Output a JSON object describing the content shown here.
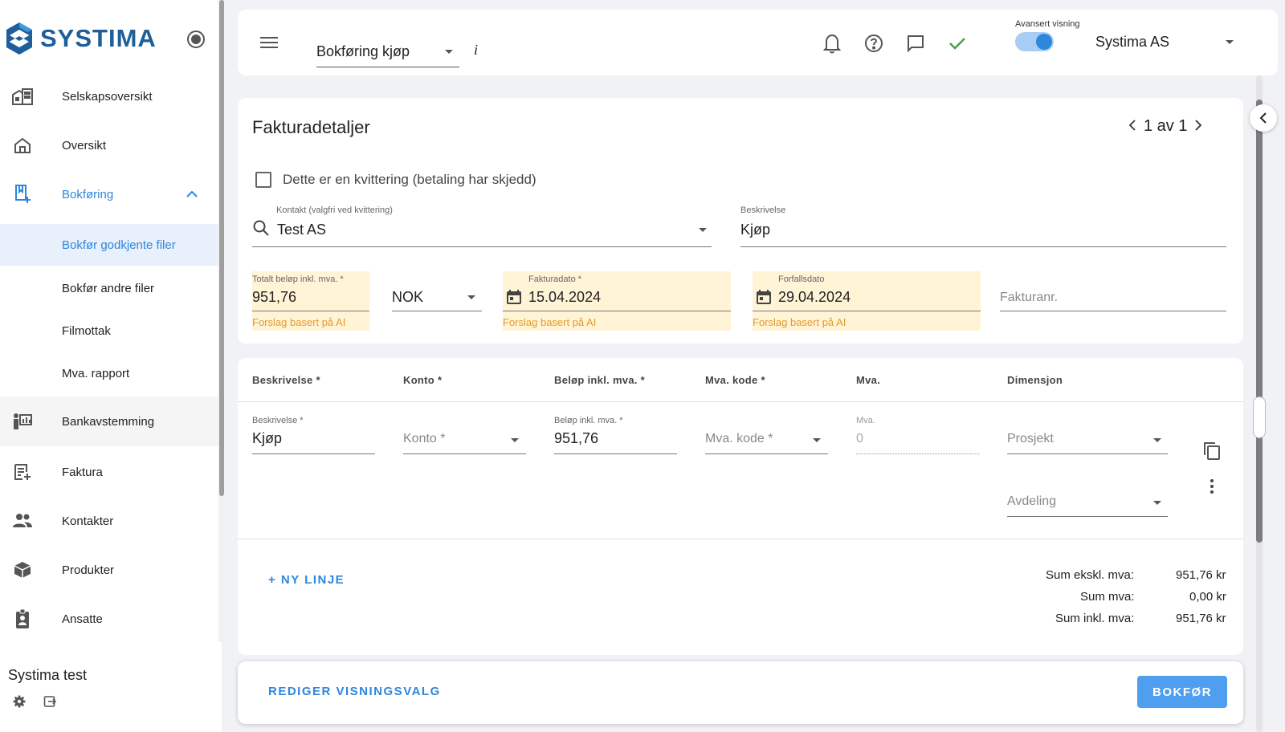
{
  "brand": {
    "name": "SYSTIMA"
  },
  "colors": {
    "accent": "#2f86dd",
    "ai_hint": "#e39a2b",
    "ai_bg": "#fff4d6",
    "success": "#43a047"
  },
  "sidebar": {
    "items": [
      {
        "label": "Selskapsoversikt",
        "icon": "building-icon"
      },
      {
        "label": "Oversikt",
        "icon": "home-icon"
      },
      {
        "label": "Bokføring",
        "icon": "bookmark-add-icon",
        "expanded": true
      },
      {
        "label": "Bankavstemming",
        "icon": "bank-reconcile-icon"
      },
      {
        "label": "Faktura",
        "icon": "invoice-icon"
      },
      {
        "label": "Kontakter",
        "icon": "people-icon"
      },
      {
        "label": "Produkter",
        "icon": "box-icon"
      },
      {
        "label": "Ansatte",
        "icon": "badge-icon"
      }
    ],
    "sub_items": [
      {
        "label": "Bokfør godkjente filer",
        "selected": true
      },
      {
        "label": "Bokfør andre filer"
      },
      {
        "label": "Filmottak"
      },
      {
        "label": "Mva. rapport"
      }
    ],
    "company": "Systima test"
  },
  "topbar": {
    "view": "Bokføring kjøp",
    "info": "i",
    "advanced_label": "Avansert visning",
    "advanced_on": true,
    "company": "Systima AS"
  },
  "details": {
    "title": "Fakturadetaljer",
    "pager": "1 av 1",
    "receipt_checkbox": "Dette er en kvittering (betaling har skjedd)",
    "contact": {
      "label": "Kontakt (valgfri ved kvittering)",
      "value": "Test AS"
    },
    "description": {
      "label": "Beskrivelse",
      "value": "Kjøp"
    },
    "amount": {
      "label": "Totalt beløp inkl. mva. *",
      "value": "951,76",
      "hint": "Forslag basert på AI"
    },
    "currency": {
      "value": "NOK"
    },
    "invoice_date": {
      "label": "Fakturadato *",
      "value": "15.04.2024",
      "hint": "Forslag basert på AI"
    },
    "due_date": {
      "label": "Forfallsdato",
      "value": "29.04.2024",
      "hint": "Forslag basert på AI"
    },
    "invoice_no": {
      "placeholder": "Fakturanr."
    }
  },
  "lines": {
    "headers": [
      "Beskrivelse *",
      "Konto *",
      "Beløp inkl. mva. *",
      "Mva. kode *",
      "Mva.",
      "Dimensjon"
    ],
    "row": {
      "description": {
        "label": "Beskrivelse *",
        "value": "Kjøp"
      },
      "account": {
        "placeholder": "Konto *"
      },
      "amount": {
        "label": "Beløp inkl. mva. *",
        "value": "951,76"
      },
      "vat_code": {
        "placeholder": "Mva. kode *"
      },
      "vat": {
        "label": "Mva.",
        "value": "0"
      },
      "project": {
        "placeholder": "Prosjekt"
      },
      "department": {
        "placeholder": "Avdeling"
      }
    },
    "new_line": "+ NY LINJE",
    "sums": [
      {
        "label": "Sum ekskl. mva:",
        "value": "951,76 kr"
      },
      {
        "label": "Sum mva:",
        "value": "0,00 kr"
      },
      {
        "label": "Sum inkl. mva:",
        "value": "951,76 kr"
      }
    ]
  },
  "actions": {
    "edit_view": "REDIGER VISNINGSVALG",
    "post": "BOKFØR"
  }
}
